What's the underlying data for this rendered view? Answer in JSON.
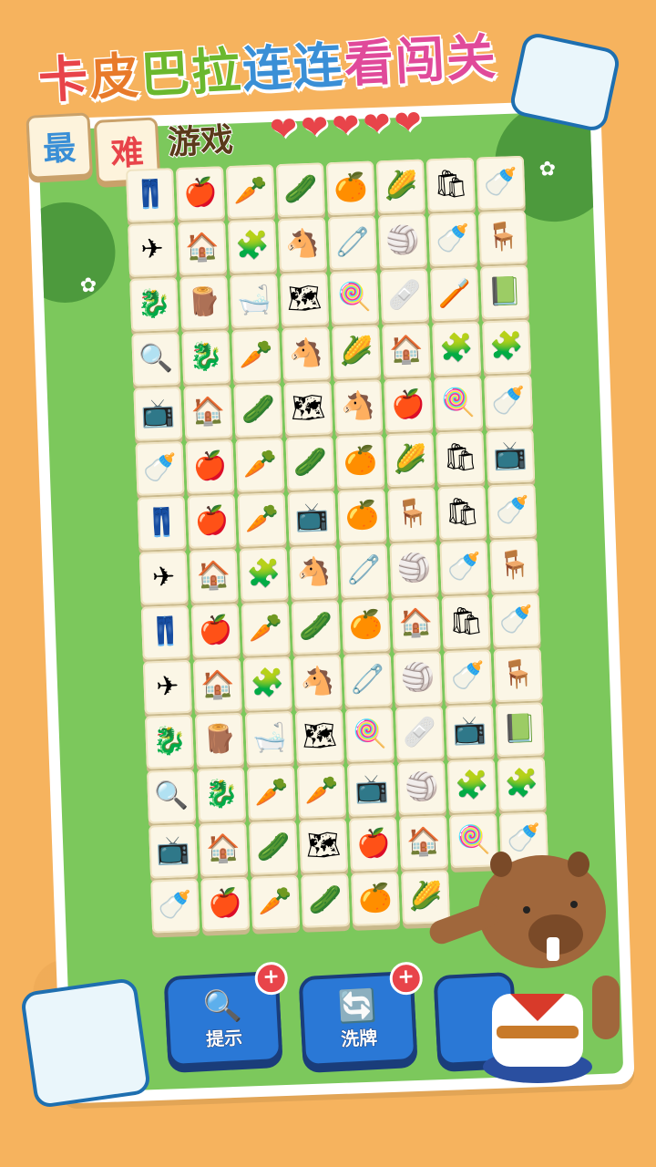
{
  "title": {
    "chars": [
      "卡",
      "皮",
      "巴",
      "拉",
      "连",
      "连",
      "看",
      "闯",
      "关"
    ],
    "colors": [
      "#e8444a",
      "#e87a2a",
      "#6bb82e",
      "#6bb82e",
      "#3a8fd6",
      "#3a8fd6",
      "#e04a9a",
      "#e04a9a",
      "#e04a9a"
    ]
  },
  "subtitle": {
    "tile1": "最",
    "tile2": "难",
    "text": "游戏"
  },
  "lives": {
    "count": 5,
    "symbol": "❤"
  },
  "board": {
    "rows": [
      [
        "👖",
        "🍎",
        "🥕",
        "🥒",
        "🍊",
        "🌽",
        "🛍",
        "🍼"
      ],
      [
        "✈",
        "🏠",
        "🧩",
        "🐴",
        "🧷",
        "🏐",
        "🍼",
        "🪑"
      ],
      [
        "🐉",
        "🪵",
        "🛁",
        "🗺",
        "🍭",
        "🩹",
        "🪥",
        "📗"
      ],
      [
        "🔍",
        "🐉",
        "🥕",
        "🐴",
        "🌽",
        "🏠",
        "🧩",
        "🧩"
      ],
      [
        "📺",
        "🏠",
        "🥒",
        "🗺",
        "🐴",
        "🍎",
        "🍭",
        "🍼"
      ],
      [
        "🍼",
        "🍎",
        "🥕",
        "🥒",
        "🍊",
        "🌽",
        "🛍",
        "📺"
      ],
      [
        "👖",
        "🍎",
        "🥕",
        "📺",
        "🍊",
        "🪑",
        "🛍",
        "🍼"
      ],
      [
        "✈",
        "🏠",
        "🧩",
        "🐴",
        "🧷",
        "🏐",
        "🍼",
        "🪑"
      ],
      [
        "👖",
        "🍎",
        "🥕",
        "🥒",
        "🍊",
        "🏠",
        "🛍",
        "🍼"
      ],
      [
        "✈",
        "🏠",
        "🧩",
        "🐴",
        "🧷",
        "🏐",
        "🍼",
        "🪑"
      ],
      [
        "🐉",
        "🪵",
        "🛁",
        "🗺",
        "🍭",
        "🩹",
        "📺",
        "📗"
      ],
      [
        "🔍",
        "🐉",
        "🥕",
        "🥕",
        "📺",
        "🏐",
        "🧩",
        "🧩"
      ],
      [
        "📺",
        "🏠",
        "🥒",
        "🗺",
        "🍎",
        "🏠",
        "🍭",
        "🍼"
      ],
      [
        "🍼",
        "🍎",
        "🥕",
        "🥒",
        "🍊",
        "🌽",
        "",
        ""
      ]
    ]
  },
  "buttons": {
    "hint": {
      "label": "提示",
      "icon": "🔍",
      "plus": "+"
    },
    "shuffle": {
      "label": "洗牌",
      "icon": "🔄",
      "plus": "+"
    },
    "third": {
      "label": "",
      "icon": "",
      "plus": ""
    }
  },
  "colors": {
    "background": "#f6b35e",
    "board_green": "#7cc85c",
    "button_blue": "#2a78d6",
    "heart_red": "#e8444a"
  }
}
